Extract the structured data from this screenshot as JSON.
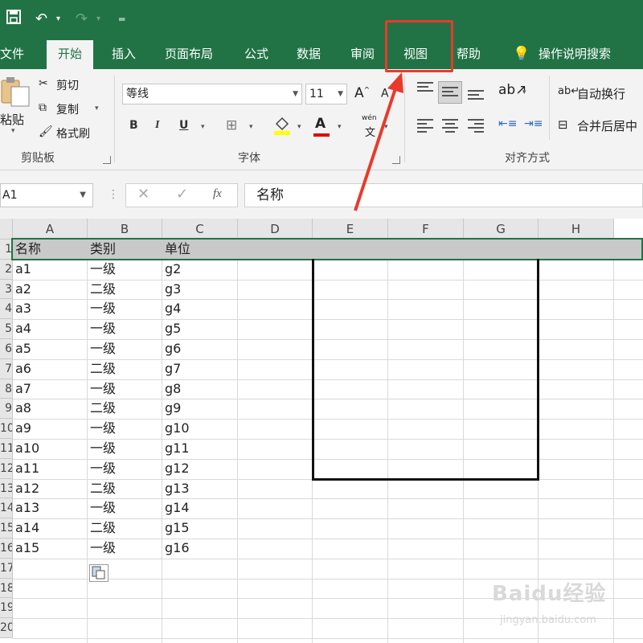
{
  "colors": {
    "excel_green": "#217346",
    "highlight_red": "#e83a2b",
    "ribbon_bg": "#f3f3f3"
  },
  "quick_access": {
    "save_icon": "save-icon",
    "undo_icon": "undo-icon",
    "redo_icon": "redo-icon",
    "customize_icon": "customize-qat-icon"
  },
  "tabs": [
    {
      "label": "文件"
    },
    {
      "label": "开始"
    },
    {
      "label": "插入"
    },
    {
      "label": "页面布局"
    },
    {
      "label": "公式"
    },
    {
      "label": "数据"
    },
    {
      "label": "审阅"
    },
    {
      "label": "视图"
    },
    {
      "label": "帮助"
    },
    {
      "label": "操作说明搜索"
    }
  ],
  "ribbon": {
    "clipboard": {
      "paste": "粘贴",
      "cut": "剪切",
      "copy": "复制",
      "format_painter": "格式刷",
      "group": "剪贴板"
    },
    "font": {
      "font_name": "等线",
      "font_size": "11",
      "bold": "B",
      "italic": "I",
      "underline": "U",
      "font_color": "A",
      "phonetic_top": "wén",
      "phonetic_bottom": "文",
      "group": "字体"
    },
    "alignment": {
      "wrap_text": "自动换行",
      "merge_center": "合并后居中",
      "group": "对齐方式"
    }
  },
  "formula_bar": {
    "name_box": "A1",
    "fx": "fx",
    "content": "名称"
  },
  "columns": [
    "A",
    "B",
    "C",
    "D",
    "E",
    "F",
    "G",
    "H"
  ],
  "rows": [
    [
      "名称",
      "类别",
      "单位"
    ],
    [
      "a1",
      "一级",
      "g2"
    ],
    [
      "a2",
      "二级",
      "g3"
    ],
    [
      "a3",
      "一级",
      "g4"
    ],
    [
      "a4",
      "一级",
      "g5"
    ],
    [
      "a5",
      "一级",
      "g6"
    ],
    [
      "a6",
      "二级",
      "g7"
    ],
    [
      "a7",
      "一级",
      "g8"
    ],
    [
      "a8",
      "二级",
      "g9"
    ],
    [
      "a9",
      "一级",
      "g10"
    ],
    [
      "a10",
      "一级",
      "g11"
    ],
    [
      "a11",
      "一级",
      "g12"
    ],
    [
      "a12",
      "二级",
      "g13"
    ],
    [
      "a13",
      "一级",
      "g14"
    ],
    [
      "a14",
      "二级",
      "g15"
    ],
    [
      "a15",
      "一级",
      "g16"
    ]
  ],
  "row_numbers": [
    "1",
    "2",
    "3",
    "4",
    "5",
    "6",
    "7",
    "8",
    "9",
    "10",
    "11",
    "12",
    "13",
    "14",
    "15",
    "16",
    "17",
    "18",
    "19",
    "20"
  ],
  "watermark": {
    "brand": "Baidu经验",
    "url": "jingyan.baidu.com"
  }
}
